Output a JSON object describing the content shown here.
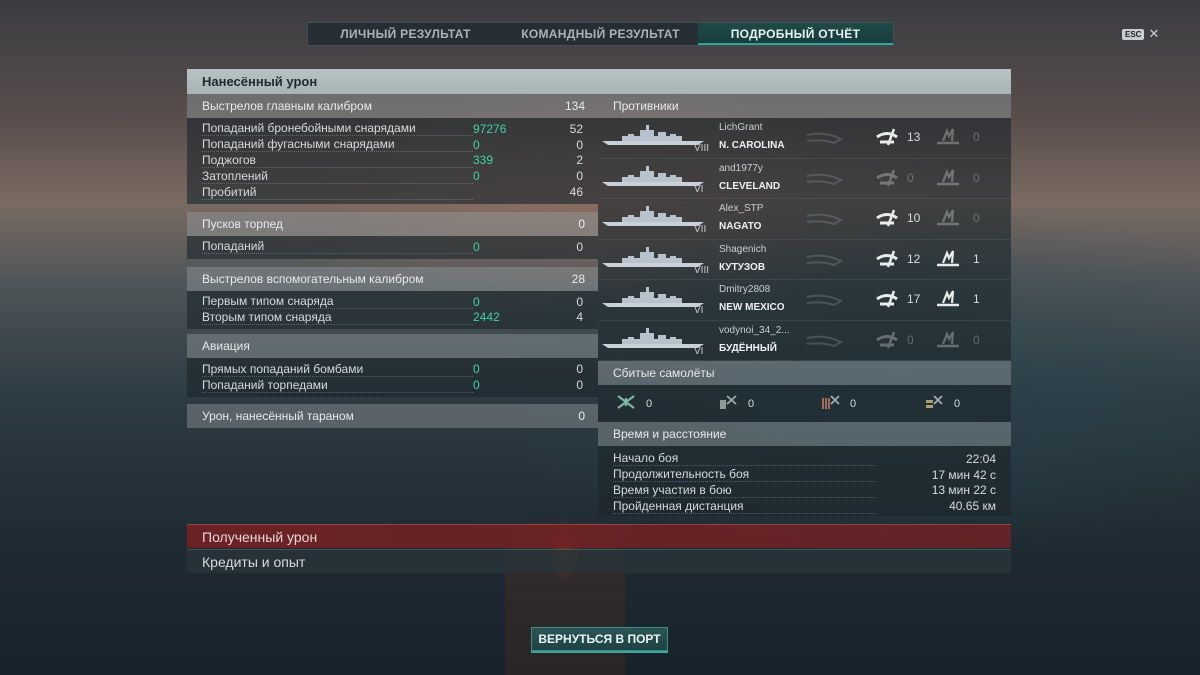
{
  "tabs": [
    {
      "label": "ЛИЧНЫЙ РЕЗУЛЬТАТ",
      "active": false
    },
    {
      "label": "КОМАНДНЫЙ РЕЗУЛЬТАТ",
      "active": false
    },
    {
      "label": "ПОДРОБНЫЙ ОТЧЁТ",
      "active": true
    }
  ],
  "esc_key": "ESC",
  "esc_close": "✕",
  "panel_title": "Нанесённый урон",
  "main_battery": {
    "title": "Выстрелов главным калибром",
    "value": "134",
    "rows": [
      {
        "label": "Попаданий бронебойными снарядами",
        "hits": "97276",
        "value": "52"
      },
      {
        "label": "Попаданий фугасными снарядами",
        "hits": "0",
        "value": "0"
      },
      {
        "label": "Поджогов",
        "hits": "339",
        "value": "2"
      },
      {
        "label": "Затоплений",
        "hits": "0",
        "value": "0"
      },
      {
        "label": "Пробитий",
        "hits": "",
        "value": "46"
      }
    ]
  },
  "torpedoes": {
    "title": "Пусков торпед",
    "value": "0",
    "rows": [
      {
        "label": "Попаданий",
        "hits": "0",
        "value": "0"
      }
    ]
  },
  "secondary": {
    "title": "Выстрелов вспомогательным калибром",
    "value": "28",
    "rows": [
      {
        "label": "Первым типом снаряда",
        "hits": "0",
        "value": "0"
      },
      {
        "label": "Вторым типом снаряда",
        "hits": "2442",
        "value": "4"
      }
    ]
  },
  "aviation": {
    "title": "Авиация",
    "rows": [
      {
        "label": "Прямых попаданий бомбами",
        "hits": "0",
        "value": "0"
      },
      {
        "label": "Попаданий торпедами",
        "hits": "0",
        "value": "0"
      }
    ]
  },
  "ramming": {
    "title": "Урон, нанесённый тараном",
    "value": "0"
  },
  "enemies": {
    "title": "Противники",
    "list": [
      {
        "player": "LichGrant",
        "ship": "N. CAROLINA",
        "tier": "VIII",
        "hits": "13",
        "fires": "0",
        "hits_active": true,
        "fires_active": false
      },
      {
        "player": "and1977y",
        "ship": "CLEVELAND",
        "tier": "VI",
        "hits": "0",
        "fires": "0",
        "hits_active": false,
        "fires_active": false
      },
      {
        "player": "Alex_STP",
        "ship": "NAGATO",
        "tier": "VII",
        "hits": "10",
        "fires": "0",
        "hits_active": true,
        "fires_active": false
      },
      {
        "player": "Shagenich",
        "ship": "КУТУЗОВ",
        "tier": "VIII",
        "hits": "12",
        "fires": "1",
        "hits_active": true,
        "fires_active": true
      },
      {
        "player": "Dmitry2808",
        "ship": "NEW MEXICO",
        "tier": "VI",
        "hits": "17",
        "fires": "1",
        "hits_active": true,
        "fires_active": true
      },
      {
        "player": "vodynoi_34_2...",
        "ship": "БУДЁННЫЙ",
        "tier": "VI",
        "hits": "0",
        "fires": "0",
        "hits_active": false,
        "fires_active": false
      }
    ]
  },
  "planes": {
    "title": "Сбитые самолёты",
    "items": [
      {
        "icon": "fighter-icon",
        "value": "0"
      },
      {
        "icon": "torpedo-bomber-icon",
        "value": "0"
      },
      {
        "icon": "dive-bomber-icon",
        "value": "0"
      },
      {
        "icon": "spotter-icon",
        "value": "0"
      }
    ]
  },
  "time": {
    "title": "Время и расстояние",
    "rows": [
      {
        "label": "Начало боя",
        "value": "22:04"
      },
      {
        "label": "Продолжительность боя",
        "value": "17 мин 42 с"
      },
      {
        "label": "Время участия в бою",
        "value": "13 мин 22 с"
      },
      {
        "label": "Пройденная дистанция",
        "value": "40.65 км"
      }
    ]
  },
  "received_damage": "Полученный урон",
  "credits_xp": "Кредиты и опыт",
  "return_button": "ВЕРНУТЬСЯ В ПОРТ",
  "colors": {
    "accent": "#34a39a",
    "hits_text": "#3fd1a6",
    "received_bar": "#782022"
  }
}
